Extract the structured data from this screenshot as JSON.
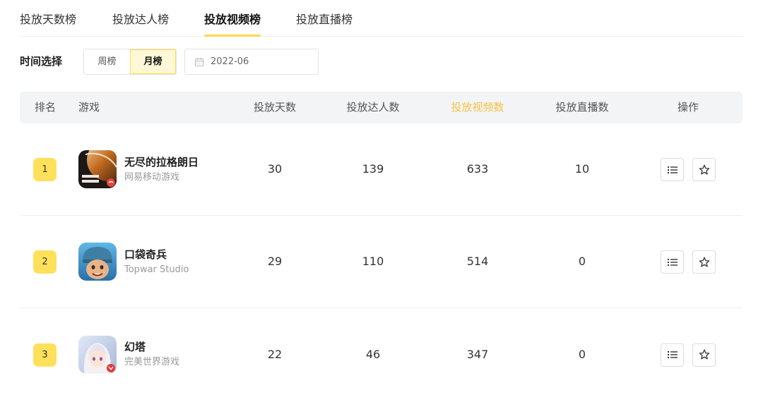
{
  "tabs": [
    {
      "label": "投放天数榜",
      "active": false
    },
    {
      "label": "投放达人榜",
      "active": false
    },
    {
      "label": "投放视频榜",
      "active": true
    },
    {
      "label": "投放直播榜",
      "active": false
    }
  ],
  "filter": {
    "label": "时间选择",
    "segments": [
      {
        "label": "周榜",
        "active": false
      },
      {
        "label": "月榜",
        "active": true
      }
    ],
    "date": {
      "value": "2022-06",
      "icon": "calendar-icon"
    }
  },
  "table": {
    "columns": [
      "排名",
      "游戏",
      "投放天数",
      "投放达人数",
      "投放视频数",
      "投放直播数",
      "操作"
    ],
    "sorted_column": "投放视频数",
    "rows": [
      {
        "rank": "1",
        "game": "无尽的拉格朗日",
        "publisher": "网易移动游戏",
        "days": "30",
        "creators": "139",
        "videos": "633",
        "lives": "10"
      },
      {
        "rank": "2",
        "game": "口袋奇兵",
        "publisher": "Topwar Studio",
        "days": "29",
        "creators": "110",
        "videos": "514",
        "lives": "0"
      },
      {
        "rank": "3",
        "game": "幻塔",
        "publisher": "完美世界游戏",
        "days": "22",
        "creators": "46",
        "videos": "347",
        "lives": "0"
      }
    ],
    "row_actions": [
      "list-icon",
      "star-icon"
    ]
  },
  "colors": {
    "accent": "#ffd84d",
    "rank_badge": "#ffe05a",
    "sorted_header": "#f5c242",
    "header_bg": "#f3f4f6"
  }
}
